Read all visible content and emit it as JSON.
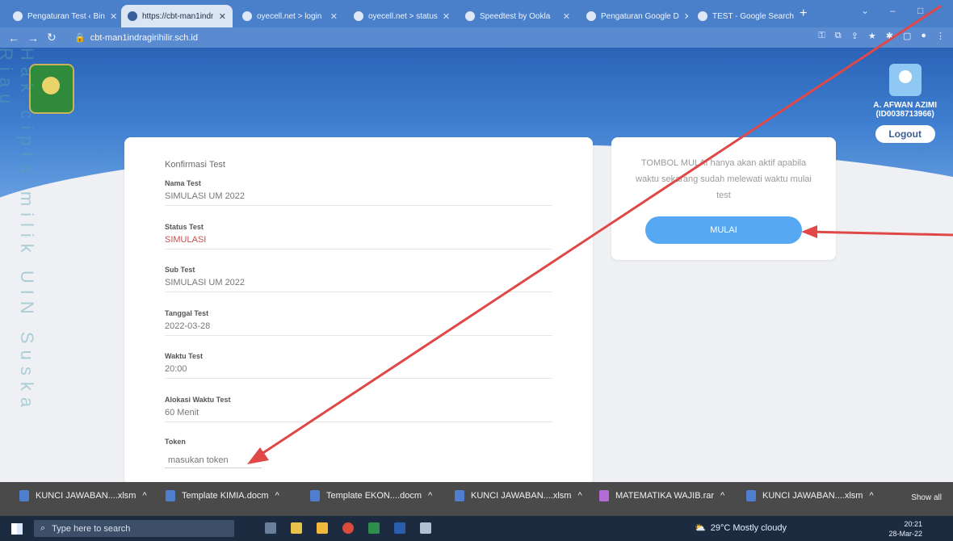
{
  "browser": {
    "tabs": [
      {
        "label": "Pengaturan Test ‹ Bin",
        "active": false
      },
      {
        "label": "https://cbt-man1indr",
        "active": true
      },
      {
        "label": "oyecell.net > login",
        "active": false
      },
      {
        "label": "oyecell.net > status",
        "active": false
      },
      {
        "label": "Speedtest by Ookla",
        "active": false
      },
      {
        "label": "Pengaturan Google D",
        "active": false
      },
      {
        "label": "TEST - Google Search",
        "active": false
      }
    ],
    "url": "cbt-man1indragirihilir.sch.id"
  },
  "header": {
    "user_name": "A. AFWAN AZIMI",
    "user_id": "(ID0038713966)",
    "logout_label": "Logout"
  },
  "confirm": {
    "title": "Konfirmasi Test",
    "fields": [
      {
        "label": "Nama Test",
        "value": "SIMULASI UM 2022"
      },
      {
        "label": "Status Test",
        "value": "SIMULASI"
      },
      {
        "label": "Sub Test",
        "value": "SIMULASI UM 2022"
      },
      {
        "label": "Tanggal Test",
        "value": "2022-03-28"
      },
      {
        "label": "Waktu Test",
        "value": "20:00"
      },
      {
        "label": "Alokasi Waktu Test",
        "value": "60 Menit"
      }
    ],
    "token_label": "Token",
    "token_placeholder": "masukan token"
  },
  "side": {
    "info_text": "TOMBOL MULAI hanya akan aktif apabila waktu sekarang sudah melewati waktu mulai test",
    "mulai_label": "MULAI"
  },
  "watermark": "Hak cipta milik UIN Suska Riau",
  "downloads": {
    "items": [
      {
        "name": "KUNCI JAWABAN....xlsm",
        "type": "excel"
      },
      {
        "name": "Template KIMIA.docm",
        "type": "word"
      },
      {
        "name": "Template EKON....docm",
        "type": "word"
      },
      {
        "name": "KUNCI JAWABAN....xlsm",
        "type": "excel"
      },
      {
        "name": "MATEMATIKA WAJIB.rar",
        "type": "rar"
      },
      {
        "name": "KUNCI JAWABAN....xlsm",
        "type": "excel"
      }
    ],
    "show_all": "Show all"
  },
  "taskbar": {
    "search_placeholder": "Type here to search",
    "weather": "29°C  Mostly cloudy",
    "time": "20:21",
    "date": "28-Mar-22"
  },
  "colors": {
    "banner": "#3f7fd0",
    "button": "#56a8f2",
    "annotation_arrow": "#e04848"
  }
}
